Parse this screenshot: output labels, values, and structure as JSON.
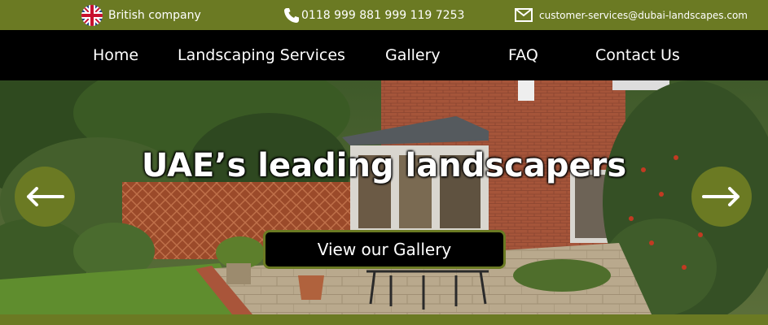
{
  "topbar": {
    "company": "British company",
    "phone": "0118 999 881 999 119 7253",
    "email": "customer-services@dubai-landscapes.com",
    "icons": {
      "flag": "uk-flag-icon",
      "phone": "phone-icon",
      "email": "envelope-icon"
    }
  },
  "nav": {
    "home": "Home",
    "services": "Landscaping Services",
    "gallery": "Gallery",
    "faq": "FAQ",
    "contact": "Contact Us"
  },
  "hero": {
    "title": "UAE’s leading landscapers",
    "cta": "View our Gallery",
    "prev_icon": "arrow-left-icon",
    "next_icon": "arrow-right-icon"
  },
  "colors": {
    "brand_green": "#6b7a23",
    "nav_bg": "#000000",
    "text": "#ffffff"
  }
}
